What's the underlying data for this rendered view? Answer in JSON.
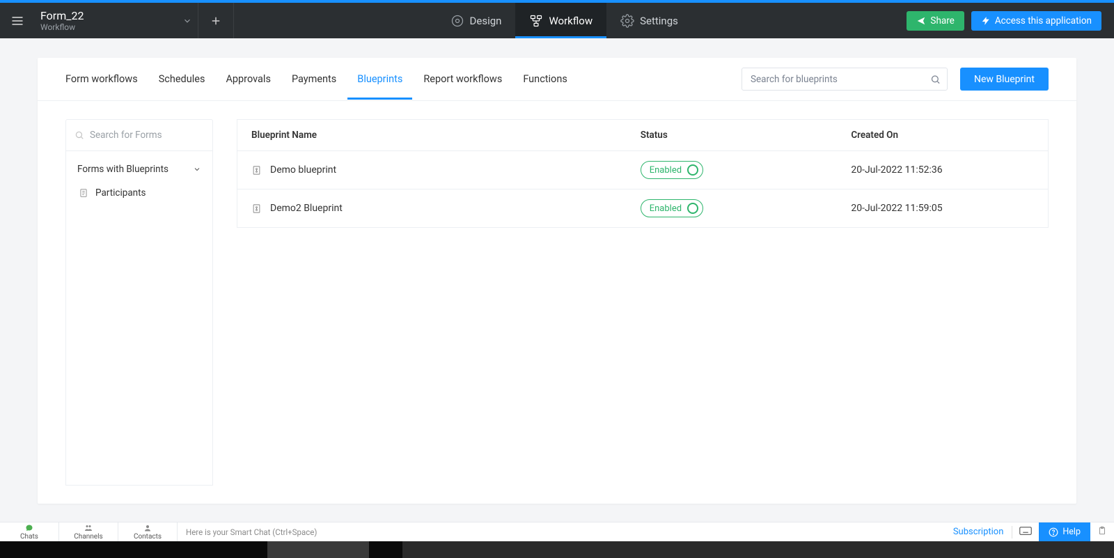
{
  "header": {
    "form_title": "Form_22",
    "form_sub": "Workflow",
    "nav": {
      "design": "Design",
      "workflow": "Workflow",
      "settings": "Settings"
    },
    "share_label": "Share",
    "access_label": "Access this application"
  },
  "tabs": {
    "form_workflows": "Form workflows",
    "schedules": "Schedules",
    "approvals": "Approvals",
    "payments": "Payments",
    "blueprints": "Blueprints",
    "report_workflows": "Report workflows",
    "functions": "Functions"
  },
  "tabbar": {
    "search_placeholder": "Search for blueprints",
    "new_blueprint": "New Blueprint"
  },
  "sidebar": {
    "search_placeholder": "Search for Forms",
    "group_label": "Forms with Blueprints",
    "items": [
      "Participants"
    ]
  },
  "table": {
    "headers": {
      "name": "Blueprint Name",
      "status": "Status",
      "created": "Created On"
    },
    "status_label": "Enabled",
    "rows": [
      {
        "name": "Demo blueprint",
        "created": "20-Jul-2022 11:52:36"
      },
      {
        "name": "Demo2 Blueprint",
        "created": "20-Jul-2022 11:59:05"
      }
    ]
  },
  "bottom": {
    "chats": "Chats",
    "channels": "Channels",
    "contacts": "Contacts",
    "hint": "Here is your Smart Chat (Ctrl+Space)",
    "subscription": "Subscription",
    "help": "Help"
  },
  "colors": {
    "accent": "#1890ff",
    "green": "#2eb56c",
    "header_bg": "#2b2f32"
  }
}
